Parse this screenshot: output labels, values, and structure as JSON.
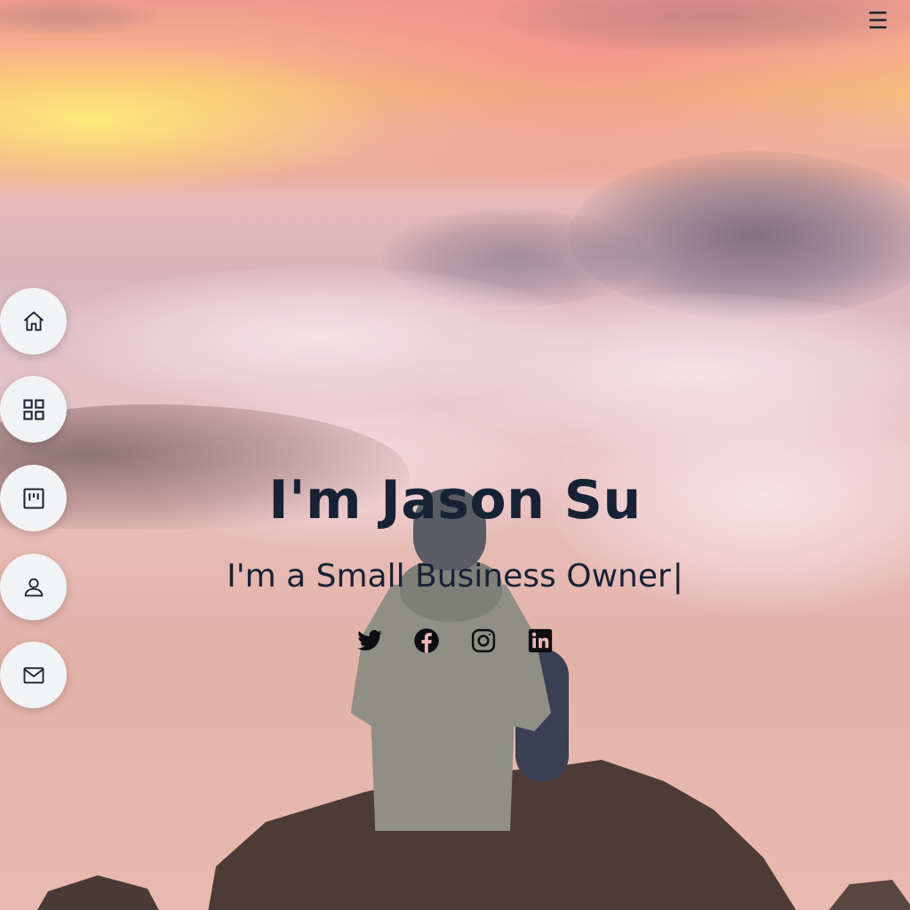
{
  "hero": {
    "title": "I'm Jason Su",
    "subtitle": "I'm a Small Business Owner",
    "caret": "|"
  },
  "social_links": [
    {
      "name": "twitter-icon"
    },
    {
      "name": "facebook-icon"
    },
    {
      "name": "instagram-icon"
    },
    {
      "name": "linkedin-icon"
    }
  ],
  "sidenav": [
    {
      "name": "home-icon"
    },
    {
      "name": "grid-icon"
    },
    {
      "name": "board-icon"
    },
    {
      "name": "user-icon"
    },
    {
      "name": "mail-icon"
    }
  ],
  "menu": {
    "toggle_glyph": "☰"
  },
  "colors": {
    "heading": "#172235",
    "nav_button_bg": "#f2f3f5"
  }
}
